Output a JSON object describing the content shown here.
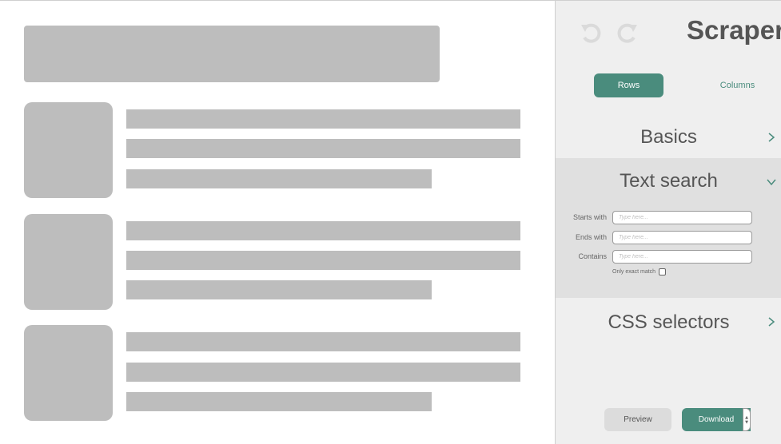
{
  "app": {
    "title": "Scraper"
  },
  "toolbar": {
    "undo_icon": "undo-icon",
    "redo_icon": "redo-icon"
  },
  "tabs": [
    {
      "label": "Rows",
      "active": true
    },
    {
      "label": "Columns",
      "active": false
    }
  ],
  "sections": {
    "basics": {
      "title": "Basics",
      "chevron": "chevron-right-icon"
    },
    "text_search": {
      "title": "Text search",
      "chevron": "chevron-down-icon",
      "fields": [
        {
          "label": "Starts with",
          "placeholder": "Type here..."
        },
        {
          "label": "Ends with",
          "placeholder": "Type here..."
        },
        {
          "label": "Contains",
          "placeholder": "Type here..."
        }
      ],
      "exact_match_label": "Only exact match"
    },
    "css_selectors": {
      "title": "CSS selectors",
      "chevron": "chevron-right-icon"
    }
  },
  "actions": {
    "preview_label": "Preview",
    "download_label": "Download",
    "stepper_up": "▲",
    "stepper_down": "▼"
  },
  "colors": {
    "accent": "#4a8c7d",
    "panel_bg": "#efefef",
    "expanded_bg": "#e0e0e0",
    "placeholder_block": "#bdbdbd"
  }
}
